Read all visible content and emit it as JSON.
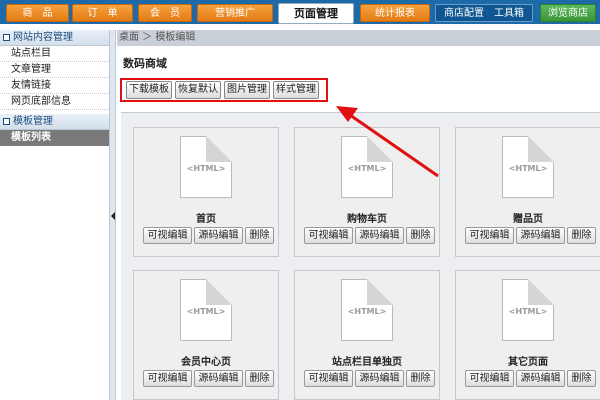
{
  "topnav": {
    "tabs": [
      {
        "label": "商　品",
        "style": "orange"
      },
      {
        "label": "订　单",
        "style": "orange"
      },
      {
        "label": "会　员",
        "style": "orange"
      },
      {
        "label": "营销推广",
        "style": "orange"
      },
      {
        "label": "页面管理",
        "style": "active"
      },
      {
        "label": "统计报表",
        "style": "orange"
      },
      {
        "label": "商店配置　工具箱",
        "style": "blue"
      },
      {
        "label": "浏览商店",
        "style": "green"
      }
    ]
  },
  "sidebar": {
    "section1": {
      "title": "网站内容管理"
    },
    "items": [
      "站点栏目",
      "文章管理",
      "友情链接",
      "网页底部信息"
    ],
    "section2": {
      "title": "模板管理"
    },
    "selected": "模板列表"
  },
  "breadcrumb": "桌面 ＞ 模板编辑",
  "panel": {
    "title": "数码商域",
    "buttons": [
      "下载模板",
      "恢复默认",
      "图片管理",
      "样式管理"
    ]
  },
  "file_icon_label": "<HTML>",
  "card_buttons": [
    "可视编辑",
    "源码编辑",
    "删除"
  ],
  "templates": [
    {
      "name": "首页"
    },
    {
      "name": "购物车页"
    },
    {
      "name": "赠品页"
    },
    {
      "name": "会员中心页"
    },
    {
      "name": "站点栏目单独页"
    },
    {
      "name": "其它页面"
    }
  ],
  "colors": {
    "nav_bg": "#1c6aa8",
    "accent_orange": "#e37a13",
    "highlight_red": "#e01010"
  }
}
